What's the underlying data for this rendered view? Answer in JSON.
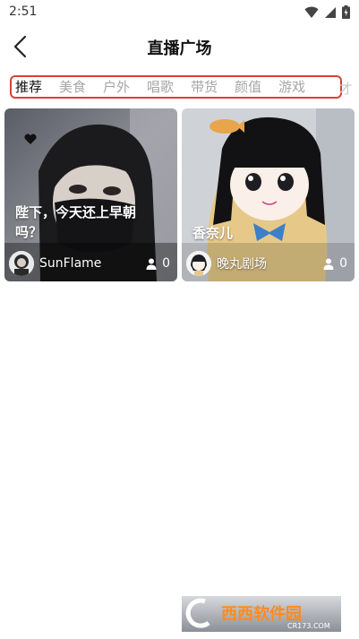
{
  "status_bar": {
    "time": "2:51"
  },
  "header": {
    "title": "直播广场"
  },
  "tabs": {
    "items": [
      "推荐",
      "美食",
      "户外",
      "唱歌",
      "带货",
      "颜值",
      "游戏"
    ],
    "active_index": 0,
    "overflow_glyph": "才"
  },
  "rooms": [
    {
      "title": "陛下，今天还上早朝吗？",
      "anchor": "SunFlame",
      "viewers": "0"
    },
    {
      "title": "香奈儿",
      "anchor": "晚丸剧场",
      "viewers": "0"
    }
  ],
  "watermark": {
    "brand": "西西软件园",
    "url": "CR173.COM"
  },
  "colors": {
    "tab_border": "#d9403a",
    "tab_active": "#111111",
    "tab_inactive": "#a6a6a6"
  }
}
